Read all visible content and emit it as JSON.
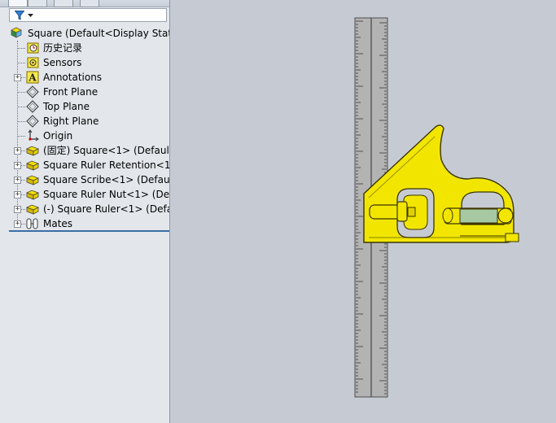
{
  "tree": {
    "filter_icon": "funnel-icon",
    "root": {
      "label": "Square  (Default<Display Stat",
      "icon": "assembly-icon"
    },
    "items": [
      {
        "label": "历史记录",
        "icon": "history-icon",
        "expandable": false
      },
      {
        "label": "Sensors",
        "icon": "sensors-icon",
        "expandable": false
      },
      {
        "label": "Annotations",
        "icon": "annotations-icon",
        "expandable": true
      },
      {
        "label": "Front Plane",
        "icon": "plane-icon",
        "expandable": false
      },
      {
        "label": "Top Plane",
        "icon": "plane-icon",
        "expandable": false
      },
      {
        "label": "Right Plane",
        "icon": "plane-icon",
        "expandable": false
      },
      {
        "label": "Origin",
        "icon": "origin-icon",
        "expandable": false
      },
      {
        "label": "(固定) Square<1> (Default",
        "icon": "part-icon",
        "expandable": true
      },
      {
        "label": "Square Ruler Retention<1:",
        "icon": "part-icon",
        "expandable": true
      },
      {
        "label": "Square Scribe<1> (Defaul",
        "icon": "part-icon",
        "expandable": true
      },
      {
        "label": "Square Ruler Nut<1> (Def",
        "icon": "part-icon",
        "expandable": true
      },
      {
        "label": "(-) Square Ruler<1> (Defa",
        "icon": "part-icon",
        "expandable": true
      },
      {
        "label": "Mates",
        "icon": "mates-icon",
        "expandable": true
      }
    ]
  },
  "colors": {
    "panel_bg": "#e3e7ec",
    "viewport_bg": "#c6cbd3",
    "part_yellow": "#f2e600",
    "ruler_gray": "#a9a9a9",
    "rod_green": "#a6c9a2",
    "selection_blue": "#3a6ea5"
  }
}
